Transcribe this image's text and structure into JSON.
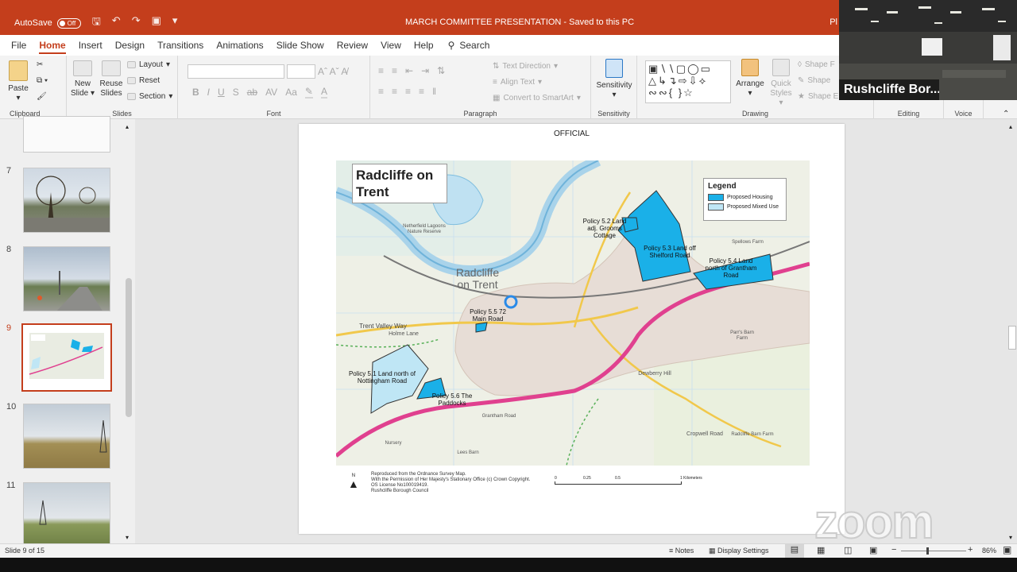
{
  "titlebar": {
    "autosave_label": "AutoSave",
    "autosave_state": "Off",
    "doc_title": "MARCH COMMITTEE PRESENTATION  -  Saved to this PC",
    "right_text": "Pl"
  },
  "tabs": [
    "File",
    "Home",
    "Insert",
    "Design",
    "Transitions",
    "Animations",
    "Slide Show",
    "Review",
    "View",
    "Help"
  ],
  "search_label": "Search",
  "ribbon": {
    "clipboard": {
      "paste": "Paste",
      "label": "Clipboard"
    },
    "slides": {
      "new_slide": "New\nSlide",
      "reuse": "Reuse\nSlides",
      "layout": "Layout",
      "reset": "Reset",
      "section": "Section",
      "label": "Slides"
    },
    "font": {
      "label": "Font"
    },
    "paragraph": {
      "text_direction": "Text Direction",
      "align_text": "Align Text",
      "smartart": "Convert to SmartArt",
      "label": "Paragraph"
    },
    "sensitivity": {
      "button": "Sensitivity",
      "label": "Sensitivity"
    },
    "drawing": {
      "arrange": "Arrange",
      "quick_styles": "Quick\nStyles",
      "shape_fill": "Shape F",
      "shape_outline": "Shape",
      "shape_effects": "Shape E",
      "label": "Drawing"
    },
    "editing": {
      "label": "Editing"
    },
    "voice": {
      "label": "Voice"
    }
  },
  "slides_panel": {
    "numbers": [
      "7",
      "8",
      "9",
      "10",
      "11"
    ],
    "selected": "9"
  },
  "slide": {
    "official": "OFFICIAL",
    "map_title": "Radcliffe on Trent",
    "legend": {
      "title": "Legend",
      "items": [
        {
          "label": "Proposed Housing",
          "color": "#1ab0e8"
        },
        {
          "label": "Proposed Mixed Use",
          "color": "#bfe6f5"
        }
      ]
    },
    "policies": {
      "p51": "Policy 5.1 Land north of Nottingham Road",
      "p52": "Policy 5.2 Land adj. Grooms Cottage",
      "p53": "Policy 5.3 Land off Shelford Road",
      "p54": "Policy 5.4 Land north of Grantham Road",
      "p55": "Policy 5.5 72 Main Road",
      "p56": "Policy 5.6 The Paddocks"
    },
    "place_names": {
      "town": "Radcliffe on Trent",
      "lagoons": "Netherfield Lagoons Nature Reserve",
      "trent_valley": "Trent Valley Way",
      "holme_lane": "Holme Lane",
      "dewberry": "Dewberry Hill",
      "cropwell": "Cropwell Road",
      "radcliffe_barn": "Radcliffe Barn Farm",
      "spellows": "Spellows Farm",
      "parrs": "Parr's Barn Farm",
      "nursery": "Nursery",
      "lees_barn": "Lees Barn",
      "grantham_rd": "Grantham Road"
    },
    "footer_lines": [
      "Reproduced from the Ordnance Survey Map.",
      "With the Permission of Her Majesty's Stationary Office (c) Crown Copyright.",
      "OS License No100019419.",
      "Rushcliffe Borough Council"
    ],
    "north_label": "N",
    "scale_labels": [
      "0",
      "0.25",
      "0.5",
      "1 Kilometers"
    ]
  },
  "status": {
    "slide_info": "Slide 9 of 15",
    "notes": "Notes",
    "display_settings": "Display Settings",
    "zoom": "86%"
  },
  "video": {
    "participant": "Rushcliffe Bor..."
  },
  "watermark": "zoom",
  "colors": {
    "accent": "#c43e1c",
    "housing": "#1ab0e8",
    "mixed_use": "#bfe6f5",
    "road_pink": "#e0408f"
  }
}
